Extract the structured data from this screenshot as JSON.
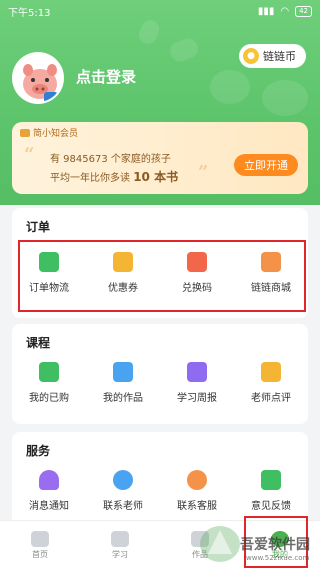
{
  "status_bar": {
    "time": "下午5:13",
    "battery": "42"
  },
  "header": {
    "coin_label": "链链币",
    "login_text": "点击登录"
  },
  "vip": {
    "tag": "简小知会员",
    "line1": "有 9845673 个家庭的孩子",
    "line2_prefix": "平均一年比你多读",
    "line2_bold": "10 本书",
    "button": "立即开通"
  },
  "orders": {
    "title": "订单",
    "items": [
      {
        "label": "订单物流",
        "icon": "list-icon",
        "color": "#3fbf62"
      },
      {
        "label": "优惠券",
        "icon": "coupon-icon",
        "color": "#f5b534"
      },
      {
        "label": "兑换码",
        "icon": "gift-icon",
        "color": "#f2664b"
      },
      {
        "label": "链链商城",
        "icon": "shop-icon",
        "color": "#f5924a"
      }
    ]
  },
  "courses": {
    "title": "课程",
    "items": [
      {
        "label": "我的已购",
        "icon": "book-icon",
        "color": "#3fbf62"
      },
      {
        "label": "我的作品",
        "icon": "image-icon",
        "color": "#49a3f1"
      },
      {
        "label": "学习周报",
        "icon": "report-icon",
        "color": "#8e6bf0"
      },
      {
        "label": "老师点评",
        "icon": "comment-icon",
        "color": "#f5b534"
      }
    ]
  },
  "services": {
    "title": "服务",
    "items": [
      {
        "label": "消息通知",
        "icon": "bell-icon",
        "color": "#9a6cf0"
      },
      {
        "label": "联系老师",
        "icon": "teacher-icon",
        "color": "#49a3f1"
      },
      {
        "label": "联系客服",
        "icon": "service-icon",
        "color": "#f5924a"
      },
      {
        "label": "意见反馈",
        "icon": "feedback-icon",
        "color": "#3fbf62"
      }
    ]
  },
  "tabbar": {
    "items": [
      {
        "label": "首页",
        "icon": "home-icon"
      },
      {
        "label": "学习",
        "icon": "study-icon"
      },
      {
        "label": "作品",
        "icon": "works-icon"
      },
      {
        "label": "我的",
        "icon": "me-icon"
      }
    ]
  },
  "watermark": {
    "text": "吾爱软件园",
    "url": "www.52zixue.com"
  }
}
